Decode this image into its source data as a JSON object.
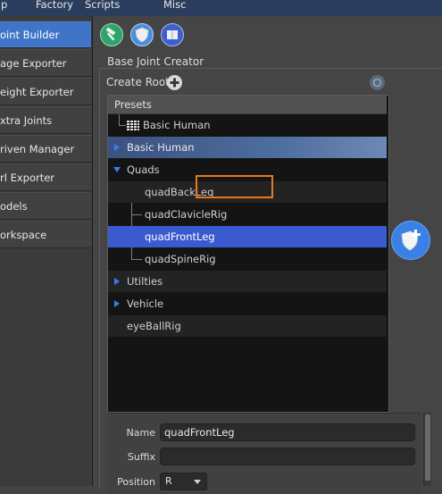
{
  "menu": {
    "items": [
      "p",
      "Factory",
      "Scripts",
      "Misc"
    ]
  },
  "sidebar": {
    "items": [
      {
        "label": "oint Builder",
        "active": true
      },
      {
        "label": "age Exporter",
        "active": false
      },
      {
        "label": "eight Exporter",
        "active": false
      },
      {
        "label": "xtra Joints",
        "active": false
      },
      {
        "label": "riven Manager",
        "active": false
      },
      {
        "label": "rl Exporter",
        "active": false
      },
      {
        "label": "odels",
        "active": false
      },
      {
        "label": "orkspace",
        "active": false
      }
    ]
  },
  "toolbar": {
    "icons": [
      "hammer-icon",
      "shield-icon",
      "book-icon"
    ]
  },
  "group": {
    "title": "Base Joint Creator",
    "create_root_label": "Create Root"
  },
  "tree": {
    "header": "Presets",
    "rows": [
      {
        "label": "Basic Human",
        "kind": "grid-leaf"
      },
      {
        "label": "Basic Human",
        "kind": "collapsed"
      },
      {
        "label": "Quads",
        "kind": "expanded"
      },
      {
        "label": "quadBackLeg",
        "kind": "child"
      },
      {
        "label": "quadClavicleRig",
        "kind": "child"
      },
      {
        "label": "quadFrontLeg",
        "kind": "child-selected"
      },
      {
        "label": "quadSpineRig",
        "kind": "child"
      },
      {
        "label": "Utilties",
        "kind": "collapsed"
      },
      {
        "label": "Vehicle",
        "kind": "collapsed"
      },
      {
        "label": "eyeBallRig",
        "kind": "leaf"
      }
    ]
  },
  "attributes": {
    "name_label": "Name",
    "name_value": "quadFrontLeg",
    "suffix_label": "Suffix",
    "suffix_value": "",
    "position_label": "Position",
    "position_value": "R"
  },
  "colors": {
    "accent": "#3f74c8",
    "selection": "#3a5bd0",
    "highlight_border": "#e67a1a",
    "menubar": "#2b3d5c"
  }
}
